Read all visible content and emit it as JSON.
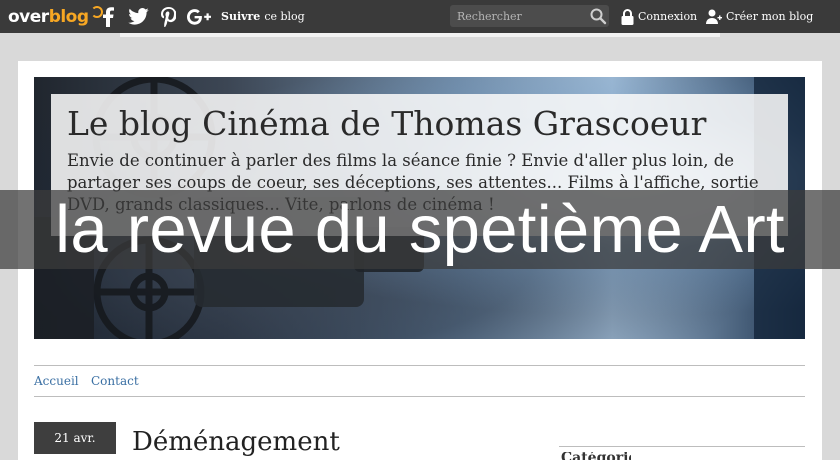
{
  "toolbar": {
    "logo_part1": "over",
    "logo_part2": "blog",
    "social_icons": [
      "facebook-icon",
      "twitter-icon",
      "pinterest-icon",
      "google-plus-icon"
    ],
    "follow_bold": "Suivre",
    "follow_rest": "ce blog",
    "search_placeholder": "Rechercher",
    "login_label": "Connexion",
    "create_label": "Créer mon blog"
  },
  "banner": {
    "title": "Le blog Cinéma de Thomas Grascoeur",
    "description": "Envie de continuer à parler des films la séance finie ? Envie d'aller plus loin, de partager ses coups de coeur, ses déceptions, ses attentes... Films à l'affiche, sortie DVD, grands classiques... Vite, parlons de cinéma !"
  },
  "overlay": {
    "text": "la revue du spetième Art"
  },
  "nav": {
    "items": [
      "Accueil",
      "Contact"
    ]
  },
  "post": {
    "date": "21 avr.",
    "title": "Déménagement"
  },
  "sidebar": {
    "fragment": "Catégories"
  },
  "colors": {
    "toolbar_bg": "#3a3a3a",
    "logo_accent": "#f7a723",
    "link": "#3a6fa3",
    "date_badge_bg": "#3e3e3e"
  }
}
